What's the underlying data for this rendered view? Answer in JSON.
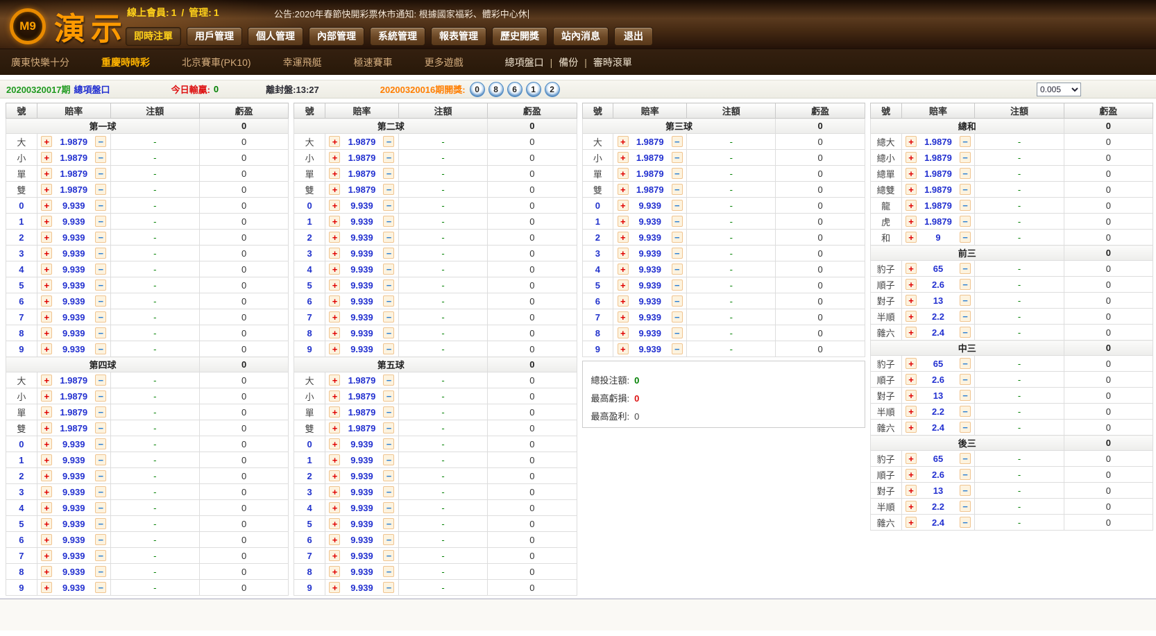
{
  "colors": {
    "brand-orange": "#ff9a00",
    "nav-active": "#ffd11a",
    "subnav-active": "#ffb400",
    "period-green": "#1f9a1f",
    "link-blue": "#2230d0",
    "loss-red": "#dd1111",
    "draw-orange": "#ff7e00",
    "odds-blue": "#2230d0",
    "plus-red": "#e00000",
    "minus-blue": "#2a7fd4",
    "profit-green": "#008000"
  },
  "header": {
    "logo": {
      "badge": "M9",
      "title": "演示"
    },
    "stats": {
      "members_label": "線上會員:",
      "members": "1",
      "separator": "/",
      "admin_label": "管理:",
      "admin": "1"
    },
    "announcement": {
      "label": "公告:",
      "text": "2020年春節快開彩票休市通知: 根據國家福彩、體彩中心休"
    },
    "nav": [
      {
        "label": "即時注單",
        "active": true
      },
      {
        "label": "用戶管理"
      },
      {
        "label": "個人管理"
      },
      {
        "label": "內部管理"
      },
      {
        "label": "系統管理"
      },
      {
        "label": "報表管理"
      },
      {
        "label": "歷史開獎"
      },
      {
        "label": "站內消息"
      },
      {
        "label": "退出"
      }
    ],
    "subnav": [
      {
        "label": "廣東快樂十分"
      },
      {
        "label": "重慶時時彩",
        "active": true
      },
      {
        "label": "北京賽車(PK10)"
      },
      {
        "label": "幸運飛艇"
      },
      {
        "label": "極速賽車"
      },
      {
        "label": "更多遊戲"
      }
    ],
    "subnav_links": [
      "總項盤口",
      "備份",
      "審時滾單"
    ],
    "subnav_separator": "|"
  },
  "infobar": {
    "period": "20200320017",
    "period_suffix": "期",
    "board_link": "總項盤口",
    "today_label": "今日輸贏:",
    "today_value": "0",
    "close_label": "離封盤:",
    "close_time": "13:27",
    "last_period": "20200320016",
    "last_label": "期開獎:",
    "balls": [
      "0",
      "8",
      "6",
      "1",
      "2"
    ],
    "rebate": "0.005"
  },
  "table": {
    "headers": [
      "號",
      "賠率",
      "注額",
      "虧盈"
    ],
    "plus": "+",
    "minus": "−",
    "dash": "-",
    "zero": "0"
  },
  "summary": {
    "items": [
      {
        "label": "總投注額:",
        "value": "0",
        "tone": "green"
      },
      {
        "label": "最高虧損:",
        "value": "0",
        "tone": "red"
      },
      {
        "label": "最高盈利:",
        "value": "0",
        "tone": "plain"
      }
    ]
  },
  "boards": [
    {
      "sections": [
        {
          "title": "第一球",
          "profit": "0",
          "rows": [
            [
              "大",
              "1.9879"
            ],
            [
              "小",
              "1.9879"
            ],
            [
              "單",
              "1.9879"
            ],
            [
              "雙",
              "1.9879"
            ],
            [
              "0",
              "9.939"
            ],
            [
              "1",
              "9.939"
            ],
            [
              "2",
              "9.939"
            ],
            [
              "3",
              "9.939"
            ],
            [
              "4",
              "9.939"
            ],
            [
              "5",
              "9.939"
            ],
            [
              "6",
              "9.939"
            ],
            [
              "7",
              "9.939"
            ],
            [
              "8",
              "9.939"
            ],
            [
              "9",
              "9.939"
            ]
          ]
        },
        {
          "title": "第四球",
          "profit": "0",
          "rows": [
            [
              "大",
              "1.9879"
            ],
            [
              "小",
              "1.9879"
            ],
            [
              "單",
              "1.9879"
            ],
            [
              "雙",
              "1.9879"
            ],
            [
              "0",
              "9.939"
            ],
            [
              "1",
              "9.939"
            ],
            [
              "2",
              "9.939"
            ],
            [
              "3",
              "9.939"
            ],
            [
              "4",
              "9.939"
            ],
            [
              "5",
              "9.939"
            ],
            [
              "6",
              "9.939"
            ],
            [
              "7",
              "9.939"
            ],
            [
              "8",
              "9.939"
            ],
            [
              "9",
              "9.939"
            ]
          ]
        }
      ]
    },
    {
      "sections": [
        {
          "title": "第二球",
          "profit": "0",
          "rows": [
            [
              "大",
              "1.9879"
            ],
            [
              "小",
              "1.9879"
            ],
            [
              "單",
              "1.9879"
            ],
            [
              "雙",
              "1.9879"
            ],
            [
              "0",
              "9.939"
            ],
            [
              "1",
              "9.939"
            ],
            [
              "2",
              "9.939"
            ],
            [
              "3",
              "9.939"
            ],
            [
              "4",
              "9.939"
            ],
            [
              "5",
              "9.939"
            ],
            [
              "6",
              "9.939"
            ],
            [
              "7",
              "9.939"
            ],
            [
              "8",
              "9.939"
            ],
            [
              "9",
              "9.939"
            ]
          ]
        },
        {
          "title": "第五球",
          "profit": "0",
          "rows": [
            [
              "大",
              "1.9879"
            ],
            [
              "小",
              "1.9879"
            ],
            [
              "單",
              "1.9879"
            ],
            [
              "雙",
              "1.9879"
            ],
            [
              "0",
              "9.939"
            ],
            [
              "1",
              "9.939"
            ],
            [
              "2",
              "9.939"
            ],
            [
              "3",
              "9.939"
            ],
            [
              "4",
              "9.939"
            ],
            [
              "5",
              "9.939"
            ],
            [
              "6",
              "9.939"
            ],
            [
              "7",
              "9.939"
            ],
            [
              "8",
              "9.939"
            ],
            [
              "9",
              "9.939"
            ]
          ]
        }
      ]
    },
    {
      "has_summary": true,
      "sections": [
        {
          "title": "第三球",
          "profit": "0",
          "rows": [
            [
              "大",
              "1.9879"
            ],
            [
              "小",
              "1.9879"
            ],
            [
              "單",
              "1.9879"
            ],
            [
              "雙",
              "1.9879"
            ],
            [
              "0",
              "9.939"
            ],
            [
              "1",
              "9.939"
            ],
            [
              "2",
              "9.939"
            ],
            [
              "3",
              "9.939"
            ],
            [
              "4",
              "9.939"
            ],
            [
              "5",
              "9.939"
            ],
            [
              "6",
              "9.939"
            ],
            [
              "7",
              "9.939"
            ],
            [
              "8",
              "9.939"
            ],
            [
              "9",
              "9.939"
            ]
          ]
        }
      ]
    },
    {
      "sections": [
        {
          "title": "總和",
          "profit": "0",
          "rows": [
            [
              "總大",
              "1.9879"
            ],
            [
              "總小",
              "1.9879"
            ],
            [
              "總單",
              "1.9879"
            ],
            [
              "總雙",
              "1.9879"
            ],
            [
              "龍",
              "1.9879"
            ],
            [
              "虎",
              "1.9879"
            ],
            [
              "和",
              "9"
            ]
          ]
        },
        {
          "title": "前三",
          "profit": "0",
          "rows": [
            [
              "豹子",
              "65"
            ],
            [
              "順子",
              "2.6"
            ],
            [
              "對子",
              "13"
            ],
            [
              "半順",
              "2.2"
            ],
            [
              "雜六",
              "2.4"
            ]
          ]
        },
        {
          "title": "中三",
          "profit": "0",
          "rows": [
            [
              "豹子",
              "65"
            ],
            [
              "順子",
              "2.6"
            ],
            [
              "對子",
              "13"
            ],
            [
              "半順",
              "2.2"
            ],
            [
              "雜六",
              "2.4"
            ]
          ]
        },
        {
          "title": "後三",
          "profit": "0",
          "rows": [
            [
              "豹子",
              "65"
            ],
            [
              "順子",
              "2.6"
            ],
            [
              "對子",
              "13"
            ],
            [
              "半順",
              "2.2"
            ],
            [
              "雜六",
              "2.4"
            ]
          ]
        }
      ]
    }
  ]
}
